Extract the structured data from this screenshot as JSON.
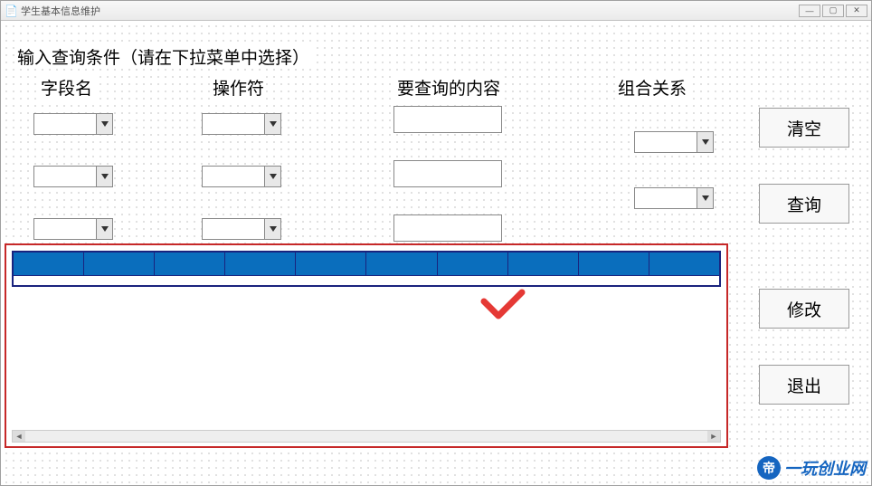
{
  "window": {
    "title": "学生基本信息维护"
  },
  "instruction": "输入查询条件（请在下拉菜单中选择）",
  "columns": {
    "field": "字段名",
    "operator": "操作符",
    "content": "要查询的内容",
    "relation": "组合关系"
  },
  "rows": [
    {
      "field": "",
      "operator": "",
      "content": "",
      "relation": ""
    },
    {
      "field": "",
      "operator": "",
      "content": "",
      "relation": ""
    },
    {
      "field": "",
      "operator": "",
      "content": ""
    }
  ],
  "buttons": {
    "clear": "清空",
    "query": "查询",
    "modify": "修改",
    "exit": "退出"
  },
  "grid": {
    "columns": [
      "",
      "",
      "",
      "",
      "",
      "",
      "",
      "",
      "",
      ""
    ],
    "rows": []
  },
  "watermark": "一玩创业网"
}
